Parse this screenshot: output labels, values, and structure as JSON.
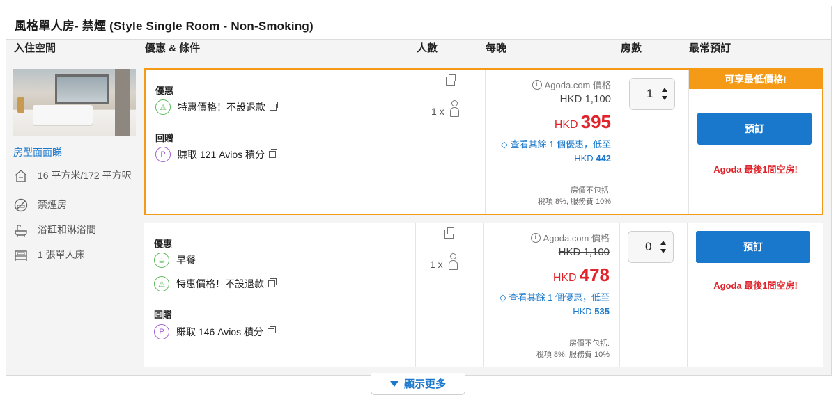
{
  "room": {
    "title": "風格單人房- 禁煙 (Style Single Room - Non-Smoking)",
    "photo_link": "房型面面睇",
    "amenities": [
      {
        "icon": "room-size-icon",
        "text": "16 平方米/172 平方呎"
      },
      {
        "icon": "no-smoking-icon",
        "text": "禁煙房"
      },
      {
        "icon": "bathtub-icon",
        "text": "浴缸和淋浴間"
      },
      {
        "icon": "bed-icon",
        "text": "1 張單人床"
      }
    ]
  },
  "columns": {
    "room_info": "入住空間",
    "offer": "優惠 & 條件",
    "pax": "人數",
    "price": "每晚",
    "qty": "房數",
    "book": "最常預訂"
  },
  "offers": [
    {
      "benefits_label": "優惠",
      "benefits": [
        "特惠價格！不設退款"
      ],
      "rewards_label": "回贈",
      "reward": "賺取 121 Avios 積分",
      "pax": "1 x",
      "price_source": "Agoda.com 價格",
      "price_old": "HKD 1,100",
      "currency": "HKD",
      "price": "395",
      "deal_text": "查看其餘 1 個優惠，低至",
      "deal_currency": "HKD",
      "deal_price": "442",
      "excl_line1": "房價不包括:",
      "excl_line2": "稅項 8%, 服務費 10%",
      "qty": "1",
      "best_badge": "可享最低價格!",
      "book_label": "預訂",
      "last_room": "Agoda 最後1間空房!"
    },
    {
      "benefits_label": "優惠",
      "benefits": [
        "早餐",
        "特惠價格！不設退款"
      ],
      "rewards_label": "回贈",
      "reward": "賺取 146 Avios 積分",
      "pax": "1 x",
      "price_source": "Agoda.com 價格",
      "price_old": "HKD 1,100",
      "currency": "HKD",
      "price": "478",
      "deal_text": "查看其餘 1 個優惠，低至",
      "deal_currency": "HKD",
      "deal_price": "535",
      "excl_line1": "房價不包括:",
      "excl_line2": "稅項 8%, 服務費 10%",
      "qty": "0",
      "book_label": "預訂",
      "last_room": "Agoda 最後1間空房!"
    }
  ],
  "show_more": "顯示更多",
  "colors": {
    "accent": "#1a78cc",
    "highlight": "#f49a16",
    "price": "#e1242b"
  }
}
